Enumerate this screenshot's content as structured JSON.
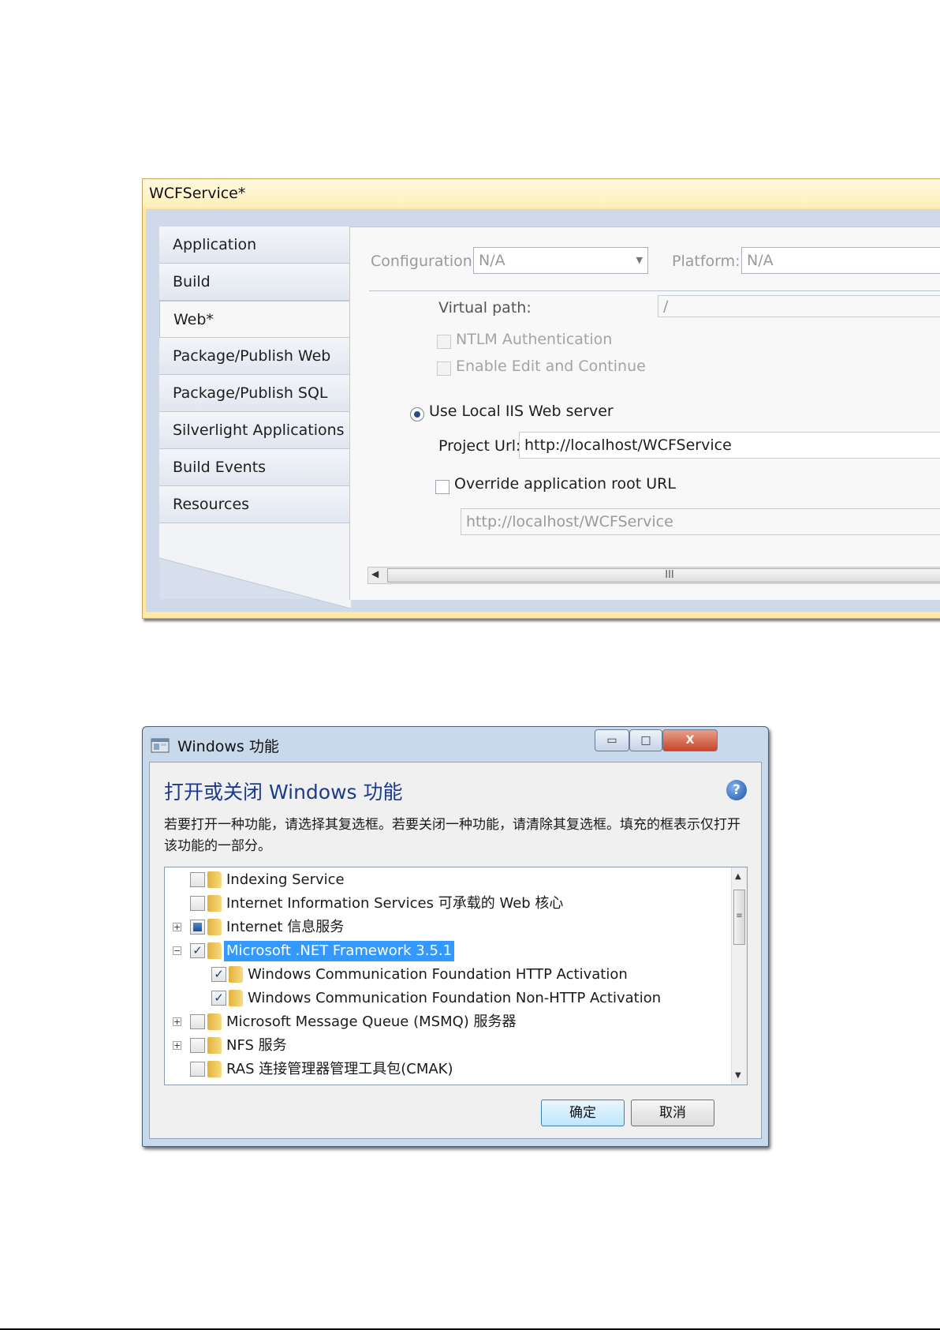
{
  "vs_panel": {
    "title": "WCFService*",
    "tabs": [
      {
        "label": "Application"
      },
      {
        "label": "Build"
      },
      {
        "label": "Web*",
        "active": true
      },
      {
        "label": "Package/Publish Web"
      },
      {
        "label": "Package/Publish SQL"
      },
      {
        "label": "Silverlight Applications"
      },
      {
        "label": "Build Events"
      },
      {
        "label": "Resources"
      }
    ],
    "more_icon": "more-tabs-icon",
    "configuration_label": "Configuration:",
    "configuration_value": "N/A",
    "platform_label": "Platform:",
    "platform_value": "N/A",
    "virtual_path_label": "Virtual path:",
    "virtual_path_value": "/",
    "ntlm_label": "NTLM Authentication",
    "edit_continue_label": "Enable Edit and Continue",
    "use_local_iis_label": "Use Local IIS Web server",
    "project_url_label": "Project Url:",
    "project_url_value": "http://localhost/WCFService",
    "override_label": "Override application root URL",
    "override_value": "http://localhost/WCFService",
    "scroll_grip": "III"
  },
  "win_dialog": {
    "title": "Windows 功能",
    "heading": "打开或关闭 Windows 功能",
    "description": "若要打开一种功能，请选择其复选框。若要关闭一种功能，请清除其复选框。填充的框表示仅打开该功能的一部分。",
    "features": [
      {
        "label": "Indexing Service",
        "state": "unchecked",
        "expander": ""
      },
      {
        "label": "Internet Information Services 可承载的 Web 核心",
        "state": "unchecked",
        "expander": ""
      },
      {
        "label": "Internet 信息服务",
        "state": "partial",
        "expander": "+"
      },
      {
        "label": "Microsoft .NET Framework 3.5.1",
        "state": "checked",
        "expander": "−",
        "selected": true
      },
      {
        "label": "Windows Communication Foundation HTTP Activation",
        "state": "checked",
        "expander": "",
        "child": true
      },
      {
        "label": "Windows Communication Foundation Non-HTTP Activation",
        "state": "checked",
        "expander": "",
        "child": true
      },
      {
        "label": "Microsoft Message Queue (MSMQ) 服务器",
        "state": "unchecked",
        "expander": "+"
      },
      {
        "label": "NFS 服务",
        "state": "unchecked",
        "expander": "+"
      },
      {
        "label": "RAS 连接管理器管理工具包(CMAK)",
        "state": "unchecked",
        "expander": ""
      }
    ],
    "check_mark": "✓",
    "ok_label": "确定",
    "cancel_label": "取消",
    "minimize_glyph": "▭",
    "maximize_glyph": "□",
    "close_glyph": "X",
    "help_glyph": "?",
    "scroll_grip": "≡"
  }
}
